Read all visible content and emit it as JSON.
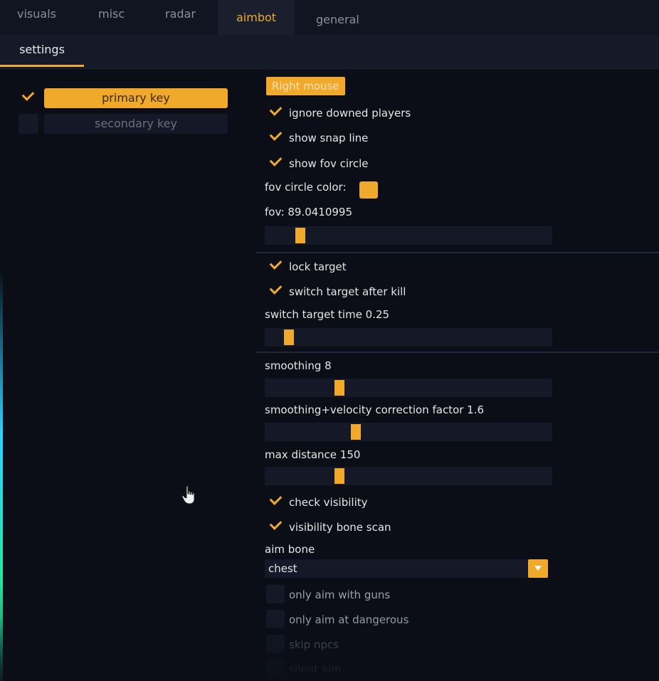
{
  "tabs": [
    "visuals",
    "misc",
    "radar",
    "aimbot",
    "general"
  ],
  "active_tab": "aimbot",
  "subtab": "settings",
  "keys": {
    "primary": "primary key",
    "secondary": "secondary key"
  },
  "aimbot": {
    "keybind": "Right mouse",
    "ignore_downed": "ignore downed players",
    "show_snap_line": "show snap line",
    "show_fov_circle": "show fov circle",
    "fov_circle_color_label": "fov circle color:",
    "fov_label": "fov: 89.0410995",
    "fov_fraction": 0.11,
    "lock_target": "lock target",
    "switch_after_kill": "switch target after kill",
    "switch_time_label": "switch target time 0.25",
    "switch_time_fraction": 0.07,
    "smoothing_label": "smoothing 8",
    "smoothing_fraction": 0.25,
    "smoothing_velocity_label": "smoothing+velocity correction factor 1.6",
    "smoothing_velocity_fraction": 0.31,
    "max_distance_label": "max distance 150",
    "max_distance_fraction": 0.25,
    "check_visibility": "check visibility",
    "visibility_bone_scan": "visibility bone scan",
    "aim_bone_label": "aim bone",
    "aim_bone_value": "chest",
    "only_aim_guns": "only aim with guns",
    "only_aim_dangerous": "only aim at dangerous",
    "skip_npcs": "skip npcs",
    "silent_aim": "silent aim"
  },
  "colors": {
    "accent": "#f0a92a",
    "background": "#0b0e16",
    "panel": "#141827"
  }
}
